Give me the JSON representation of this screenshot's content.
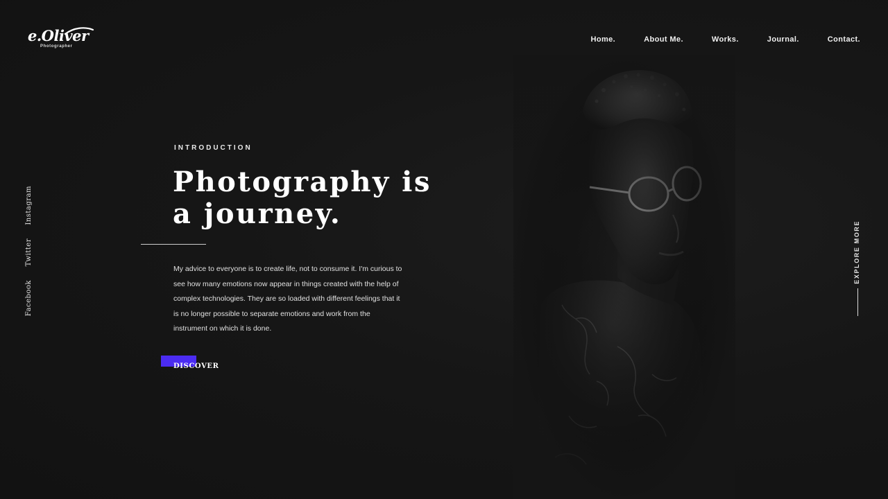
{
  "brand": {
    "logo_text": "e.Oliver",
    "logo_sub": "Photographer"
  },
  "nav": {
    "items": [
      {
        "label": "Home.",
        "active": true
      },
      {
        "label": "About Me.",
        "active": false
      },
      {
        "label": "Works.",
        "active": false
      },
      {
        "label": "Journal.",
        "active": false
      },
      {
        "label": "Contact.",
        "active": false
      }
    ]
  },
  "social": {
    "links": [
      "Instagram",
      "Twitter",
      "Facebook"
    ]
  },
  "hero": {
    "eyebrow": "INTRODUCTION",
    "headline_line1": "Photography is",
    "headline_line2": "a journey.",
    "body": "My advice to everyone is to create life, not to consume it. I'm curious to see how many emotions now appear in things created with the help of complex technologies. They are so loaded with different feelings that it is no longer possible to separate emotions and work from the instrument on which it is done.",
    "cta_label": "DISCOVER"
  },
  "side": {
    "explore_label": "EXPLORE MORE"
  },
  "colors": {
    "accent": "#4b2cf2",
    "background": "#151515",
    "text": "#ffffff"
  },
  "icons": {
    "portrait": "portrait-photo"
  }
}
